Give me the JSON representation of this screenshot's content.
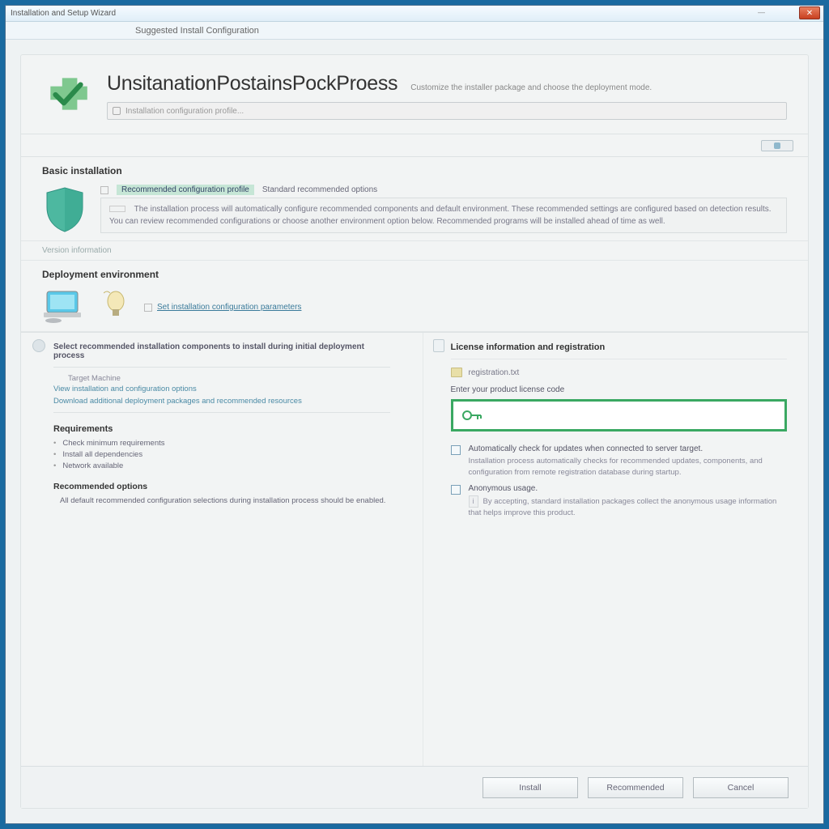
{
  "window": {
    "title": "Installation and Setup Wizard",
    "menu": "Suggested Install Configuration",
    "close_label": "✕"
  },
  "header": {
    "title": "UnsitanationPostainsPockProess",
    "subtitle": "Customize the installer package and choose the deployment mode.",
    "input_placeholder": "Installation configuration profile..."
  },
  "section1": {
    "title": "Basic installation",
    "line1_hl": "Recommended configuration profile",
    "line1_rest": "Standard recommended options",
    "box_text": "The installation process will automatically configure recommended components and default environment. These recommended settings are configured based on detection results. You can review recommended configurations or choose another environment option below. Recommended programs will be installed ahead of time as well."
  },
  "meta_line": "Version information",
  "section2": {
    "title": "Deployment environment",
    "link_text": "Set installation configuration parameters"
  },
  "left": {
    "heading": "Select recommended installation components to install during initial deployment process",
    "item1": "Target Machine",
    "link1": "View installation and configuration options",
    "link2": "Download additional deployment packages and recommended resources",
    "h2": "Requirements",
    "r1": "Check minimum requirements",
    "r2": "Install all dependencies",
    "r3": "Network available",
    "h3": "Recommended options",
    "desc3": "All default recommended configuration selections during installation process should be enabled."
  },
  "right": {
    "heading": "License information and registration",
    "folder_label": "registration.txt",
    "field_label": "Enter your product license code",
    "chk1": "Automatically check for updates when connected to server target.",
    "chk1_desc": "Installation process automatically checks for recommended updates, components, and configuration from remote registration database during startup.",
    "chk2": "Anonymous usage.",
    "chk2_desc": "By accepting, standard installation packages collect the anonymous usage information that helps improve this product."
  },
  "footer": {
    "btn1": "Install",
    "btn2": "Recommended",
    "btn3": "Cancel"
  }
}
